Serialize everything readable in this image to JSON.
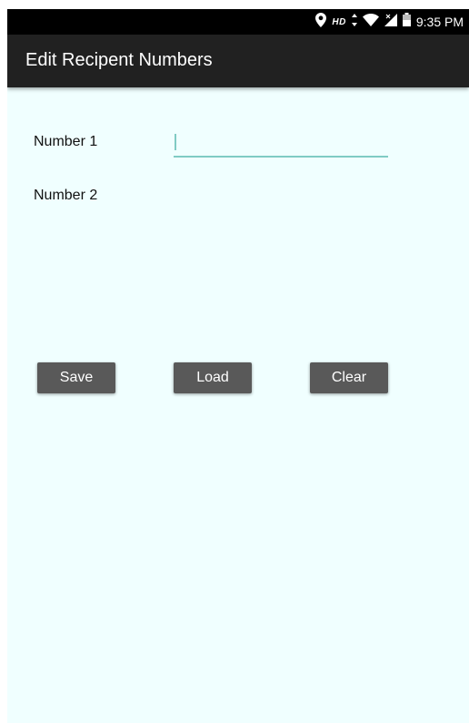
{
  "status_bar": {
    "time": "9:35 PM",
    "hd_label": "HD",
    "icons": [
      "location-icon",
      "data-arrows-icon",
      "wifi-icon",
      "signal-icon",
      "battery-icon"
    ]
  },
  "app_bar": {
    "title": "Edit Recipent Numbers"
  },
  "form": {
    "number1_label": "Number 1",
    "number1_value": "",
    "number2_label": "Number 2",
    "number2_value": ""
  },
  "buttons": {
    "save": "Save",
    "load": "Load",
    "clear": "Clear"
  },
  "colors": {
    "background": "#F0FFFF",
    "app_bar": "#212121",
    "accent": "#80CBC4",
    "button": "#595959"
  }
}
